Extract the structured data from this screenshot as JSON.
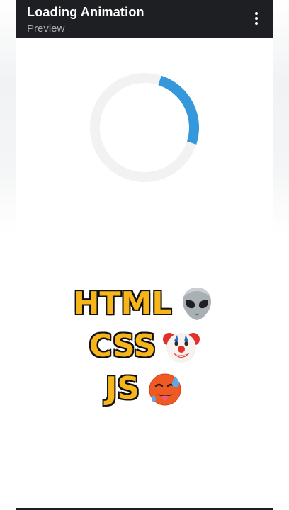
{
  "appbar": {
    "title": "Loading Animation",
    "subtitle": "Preview",
    "menu_icon": "more-vertical-icon"
  },
  "preview": {
    "spinner": {
      "track_color": "#f2f2f2",
      "arc_color": "#3498db",
      "arc_fraction": 0.25
    }
  },
  "caption": {
    "lines": [
      {
        "text": "HTML",
        "emoji": "alien-emoji"
      },
      {
        "text": "CSS",
        "emoji": "clown-face-emoji"
      },
      {
        "text": "JS",
        "emoji": "hot-face-emoji"
      }
    ],
    "text_color": "#f7b51c",
    "outline_color": "#111111"
  }
}
